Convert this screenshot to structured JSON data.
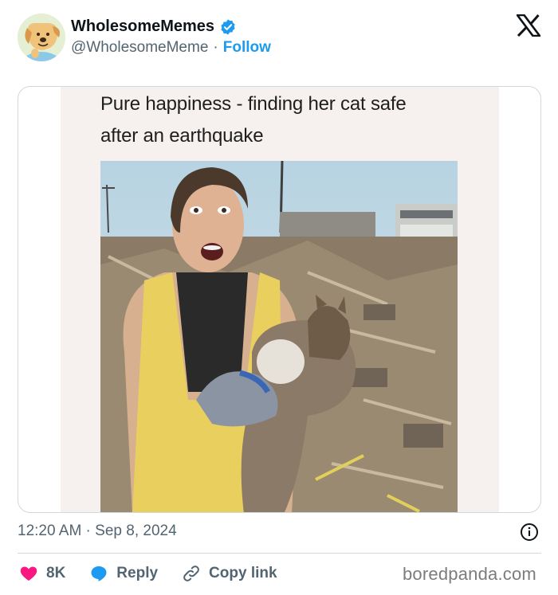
{
  "account": {
    "display_name": "WholesomeMemes",
    "handle": "@WholesomeMeme",
    "separator": "·",
    "follow_label": "Follow"
  },
  "media": {
    "caption_line1": "Pure happiness - finding her cat safe",
    "caption_line2": "after an earthquake"
  },
  "meta": {
    "timestamp": "12:20 AM · Sep 8, 2024"
  },
  "actions": {
    "like_count": "8K",
    "reply_label": "Reply",
    "copy_link_label": "Copy link"
  },
  "watermark": "boredpanda.com",
  "colors": {
    "accent": "#1d9bf0",
    "like": "#f91880",
    "muted": "#536471"
  }
}
